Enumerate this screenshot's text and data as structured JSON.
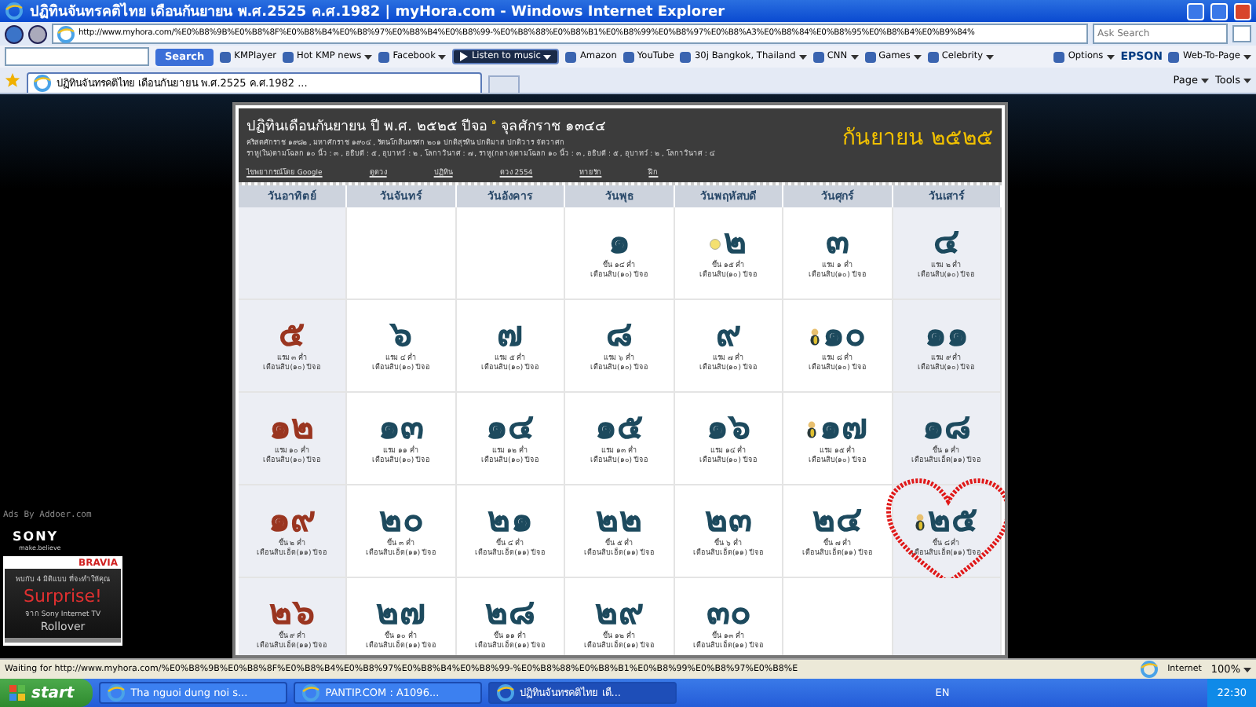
{
  "window": {
    "title": "ปฏิทินจันทรคติไทย เดือนกันยายน พ.ศ.2525 ค.ศ.1982 | myHora.com - Windows Internet Explorer"
  },
  "address_bar": {
    "url": "http://www.myhora.com/%E0%B8%9B%E0%B8%8F%E0%B8%B4%E0%B8%97%E0%B8%B4%E0%B8%99-%E0%B8%88%E0%B8%B1%E0%B8%99%E0%B8%97%E0%B8%A3%E0%B8%84%E0%B8%95%E0%B8%B4%E0%B9%84%",
    "search_placeholder": "Ask Search"
  },
  "toolbar": {
    "search_button": "Search",
    "items": [
      {
        "label": "KMPlayer",
        "kind": "link",
        "dropdown": false
      },
      {
        "label": "Hot KMP news",
        "kind": "link",
        "dropdown": true
      },
      {
        "label": "Facebook",
        "kind": "link",
        "dropdown": true
      },
      {
        "label": "Listen to music",
        "kind": "player",
        "dropdown": true
      },
      {
        "label": "Amazon",
        "kind": "link",
        "dropdown": false
      },
      {
        "label": "YouTube",
        "kind": "link",
        "dropdown": false
      },
      {
        "label": "30j Bangkok, Thailand",
        "kind": "link",
        "dropdown": true
      },
      {
        "label": "CNN",
        "kind": "link",
        "dropdown": true
      },
      {
        "label": "Games",
        "kind": "link",
        "dropdown": true
      },
      {
        "label": "Celebrity",
        "kind": "link",
        "dropdown": true
      }
    ],
    "right_items": [
      {
        "label": "Options",
        "kind": "link",
        "dropdown": true
      },
      {
        "label": "EPSON",
        "kind": "brand",
        "dropdown": false
      },
      {
        "label": "Web-To-Page",
        "kind": "link",
        "dropdown": true
      }
    ]
  },
  "tab": {
    "title": "ปฏิทินจันทรคติไทย เดือนกันยายน พ.ศ.2525 ค.ศ.1982 ...",
    "selected": true
  },
  "commands": [
    "Page",
    "Tools"
  ],
  "calendar": {
    "title": "ปฏิทินเดือนกันยายน ปี พ.ศ. ๒๕๒๕ ปีจอ $^{๑}$ จุลศักราช ๑๓๔๔",
    "subtitle": "คริสตศักราช ๑๙๘๒ , มหาศักราช ๑๙๐๔ , รัตนโกสินทรศก ๒๐๑ ปกติสุรทิน ปกติมาส ปกติวาร จัตวาศก",
    "details": "ราหู(ใน)ตามโฉลก ๑๐ นิ้ว : ๓ , อธิบดี : ๕ , อุบาทว์ : ๒ , โลกาวินาศ : ๗ , ราหู(กลาง)ตามโฉลก ๑๐ นิ้ว : ๓ , อธิบดี : ๕ , อุบาทว์ : ๒ , โลกาวินาศ : ๔",
    "month_badge": "กันยายน ๒๕๒๕",
    "links": [
      "ไขพยากรณ์โดย Google",
      "ดูดวง",
      "ปฏิทิน",
      "ดวง 2554",
      "ทายรัก",
      "ฝึก"
    ],
    "columns": [
      {
        "label": "วันอาทิตย์",
        "shaded": true,
        "red": true
      },
      {
        "label": "วันจันทร์",
        "shaded": false,
        "red": false
      },
      {
        "label": "วันอังคาร",
        "shaded": false,
        "red": false
      },
      {
        "label": "วันพุธ",
        "shaded": false,
        "red": false
      },
      {
        "label": "วันพฤหัสบดี",
        "shaded": false,
        "red": false
      },
      {
        "label": "วันศุกร์",
        "shaded": false,
        "red": false
      },
      {
        "label": "วันเสาร์",
        "shaded": true,
        "red": false
      }
    ],
    "weeks": [
      [
        {
          "kind": "empty"
        },
        {
          "kind": "empty"
        },
        {
          "kind": "empty"
        },
        {
          "kind": "day",
          "day": "๑",
          "lunar": "ขึ้น ๑๔ ค่ำ",
          "month": "เดือนสิบ(๑๐) ปีจอ",
          "moon": false,
          "figure": false,
          "highlighted": false
        },
        {
          "kind": "day",
          "day": "๒",
          "lunar": "ขึ้น ๑๕ ค่ำ",
          "month": "เดือนสิบ(๑๐) ปีจอ",
          "moon": true,
          "figure": false,
          "highlighted": false
        },
        {
          "kind": "day",
          "day": "๓",
          "lunar": "แรม ๑ ค่ำ",
          "month": "เดือนสิบ(๑๐) ปีจอ",
          "moon": false,
          "figure": false,
          "highlighted": false
        },
        {
          "kind": "day",
          "day": "๔",
          "lunar": "แรม ๒ ค่ำ",
          "month": "เดือนสิบ(๑๐) ปีจอ",
          "moon": false,
          "figure": false,
          "highlighted": false
        }
      ],
      [
        {
          "kind": "day",
          "day": "๕",
          "lunar": "แรม ๓ ค่ำ",
          "month": "เดือนสิบ(๑๐) ปีจอ",
          "moon": false,
          "figure": false,
          "highlighted": false
        },
        {
          "kind": "day",
          "day": "๖",
          "lunar": "แรม ๔ ค่ำ",
          "month": "เดือนสิบ(๑๐) ปีจอ",
          "moon": false,
          "figure": false,
          "highlighted": false
        },
        {
          "kind": "day",
          "day": "๗",
          "lunar": "แรม ๕ ค่ำ",
          "month": "เดือนสิบ(๑๐) ปีจอ",
          "moon": false,
          "figure": false,
          "highlighted": false
        },
        {
          "kind": "day",
          "day": "๘",
          "lunar": "แรม ๖ ค่ำ",
          "month": "เดือนสิบ(๑๐) ปีจอ",
          "moon": false,
          "figure": false,
          "highlighted": false
        },
        {
          "kind": "day",
          "day": "๙",
          "lunar": "แรม ๗ ค่ำ",
          "month": "เดือนสิบ(๑๐) ปีจอ",
          "moon": false,
          "figure": false,
          "highlighted": false
        },
        {
          "kind": "day",
          "day": "๑๐",
          "lunar": "แรม ๘ ค่ำ",
          "month": "เดือนสิบ(๑๐) ปีจอ",
          "moon": false,
          "figure": true,
          "highlighted": false
        },
        {
          "kind": "day",
          "day": "๑๑",
          "lunar": "แรม ๙ ค่ำ",
          "month": "เดือนสิบ(๑๐) ปีจอ",
          "moon": false,
          "figure": false,
          "highlighted": false
        }
      ],
      [
        {
          "kind": "day",
          "day": "๑๒",
          "lunar": "แรม ๑๐ ค่ำ",
          "month": "เดือนสิบ(๑๐) ปีจอ",
          "moon": false,
          "figure": false,
          "highlighted": false
        },
        {
          "kind": "day",
          "day": "๑๓",
          "lunar": "แรม ๑๑ ค่ำ",
          "month": "เดือนสิบ(๑๐) ปีจอ",
          "moon": false,
          "figure": false,
          "highlighted": false
        },
        {
          "kind": "day",
          "day": "๑๔",
          "lunar": "แรม ๑๒ ค่ำ",
          "month": "เดือนสิบ(๑๐) ปีจอ",
          "moon": false,
          "figure": false,
          "highlighted": false
        },
        {
          "kind": "day",
          "day": "๑๕",
          "lunar": "แรม ๑๓ ค่ำ",
          "month": "เดือนสิบ(๑๐) ปีจอ",
          "moon": false,
          "figure": false,
          "highlighted": false
        },
        {
          "kind": "day",
          "day": "๑๖",
          "lunar": "แรม ๑๔ ค่ำ",
          "month": "เดือนสิบ(๑๐) ปีจอ",
          "moon": false,
          "figure": false,
          "highlighted": false
        },
        {
          "kind": "day",
          "day": "๑๗",
          "lunar": "แรม ๑๕ ค่ำ",
          "month": "เดือนสิบ(๑๐) ปีจอ",
          "moon": false,
          "figure": true,
          "highlighted": false
        },
        {
          "kind": "day",
          "day": "๑๘",
          "lunar": "ขึ้น ๑ ค่ำ",
          "month": "เดือนสิบเอ็ด(๑๑) ปีจอ",
          "moon": false,
          "figure": false,
          "highlighted": false
        }
      ],
      [
        {
          "kind": "day",
          "day": "๑๙",
          "lunar": "ขึ้น ๒ ค่ำ",
          "month": "เดือนสิบเอ็ด(๑๑) ปีจอ",
          "moon": false,
          "figure": false,
          "highlighted": false
        },
        {
          "kind": "day",
          "day": "๒๐",
          "lunar": "ขึ้น ๓ ค่ำ",
          "month": "เดือนสิบเอ็ด(๑๑) ปีจอ",
          "moon": false,
          "figure": false,
          "highlighted": false
        },
        {
          "kind": "day",
          "day": "๒๑",
          "lunar": "ขึ้น ๔ ค่ำ",
          "month": "เดือนสิบเอ็ด(๑๑) ปีจอ",
          "moon": false,
          "figure": false,
          "highlighted": false
        },
        {
          "kind": "day",
          "day": "๒๒",
          "lunar": "ขึ้น ๕ ค่ำ",
          "month": "เดือนสิบเอ็ด(๑๑) ปีจอ",
          "moon": false,
          "figure": false,
          "highlighted": false
        },
        {
          "kind": "day",
          "day": "๒๓",
          "lunar": "ขึ้น ๖ ค่ำ",
          "month": "เดือนสิบเอ็ด(๑๑) ปีจอ",
          "moon": false,
          "figure": false,
          "highlighted": false
        },
        {
          "kind": "day",
          "day": "๒๔",
          "lunar": "ขึ้น ๗ ค่ำ",
          "month": "เดือนสิบเอ็ด(๑๑) ปีจอ",
          "moon": false,
          "figure": false,
          "highlighted": false
        },
        {
          "kind": "day",
          "day": "๒๕",
          "lunar": "ขึ้น ๘ ค่ำ",
          "month": "เดือนสิบเอ็ด(๑๑) ปีจอ",
          "moon": false,
          "figure": true,
          "highlighted": true
        }
      ],
      [
        {
          "kind": "day",
          "day": "๒๖",
          "lunar": "ขึ้น ๙ ค่ำ",
          "month": "เดือนสิบเอ็ด(๑๑) ปีจอ",
          "moon": false,
          "figure": false,
          "highlighted": false
        },
        {
          "kind": "day",
          "day": "๒๗",
          "lunar": "ขึ้น ๑๐ ค่ำ",
          "month": "เดือนสิบเอ็ด(๑๑) ปีจอ",
          "moon": false,
          "figure": false,
          "highlighted": false
        },
        {
          "kind": "day",
          "day": "๒๘",
          "lunar": "ขึ้น ๑๑ ค่ำ",
          "month": "เดือนสิบเอ็ด(๑๑) ปีจอ",
          "moon": false,
          "figure": false,
          "highlighted": false
        },
        {
          "kind": "day",
          "day": "๒๙",
          "lunar": "ขึ้น ๑๒ ค่ำ",
          "month": "เดือนสิบเอ็ด(๑๑) ปีจอ",
          "moon": false,
          "figure": false,
          "highlighted": false
        },
        {
          "kind": "day",
          "day": "๓๐",
          "lunar": "ขึ้น ๑๓ ค่ำ",
          "month": "เดือนสิบเอ็ด(๑๑) ปีจอ",
          "moon": false,
          "figure": false,
          "highlighted": false
        },
        {
          "kind": "empty"
        },
        {
          "kind": "empty"
        }
      ]
    ]
  },
  "ad": {
    "credit": "Ads By Addoer.com",
    "brand": "SONY",
    "tagline": "make.believe",
    "product": "BRAVIA",
    "lines": [
      "พบกับ 4 มิติแบบ ที่จะทำให้คุณ",
      "Surprise!",
      "จาก Sony Internet TV",
      "Rollover"
    ]
  },
  "status_bar": {
    "text": "Waiting for http://www.myhora.com/%E0%B8%9B%E0%B8%8F%E0%B8%B4%E0%B8%97%E0%B8%B4%E0%B8%99-%E0%B8%88%E0%B8%B1%E0%B8%99%E0%B8%97%E0%B8%E",
    "zone": "Internet",
    "zoom": "100%"
  },
  "taskbar": {
    "start": "start",
    "tasks": [
      {
        "label": "Tha nguoi dung noi s...",
        "selected": false
      },
      {
        "label": "PANTIP.COM : A1096...",
        "selected": false
      },
      {
        "label": "ปฏิทินจันทรคติไทย เดื...",
        "selected": true
      }
    ],
    "language": "EN",
    "clock": "22:30"
  }
}
